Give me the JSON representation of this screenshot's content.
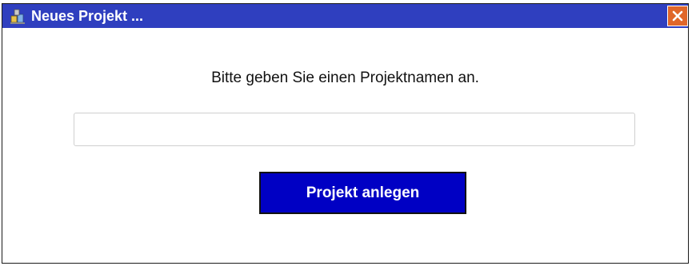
{
  "window": {
    "title": "Neues Projekt ...",
    "title_icon": "project-blocks-icon",
    "close_icon": "close-icon",
    "accent_color": "#2f3fbf",
    "close_color": "#e0672a"
  },
  "dialog": {
    "prompt": "Bitte geben Sie einen Projektnamen an.",
    "project_name_value": "",
    "project_name_placeholder": "",
    "create_button_label": "Projekt anlegen",
    "create_button_color": "#0000c4"
  }
}
